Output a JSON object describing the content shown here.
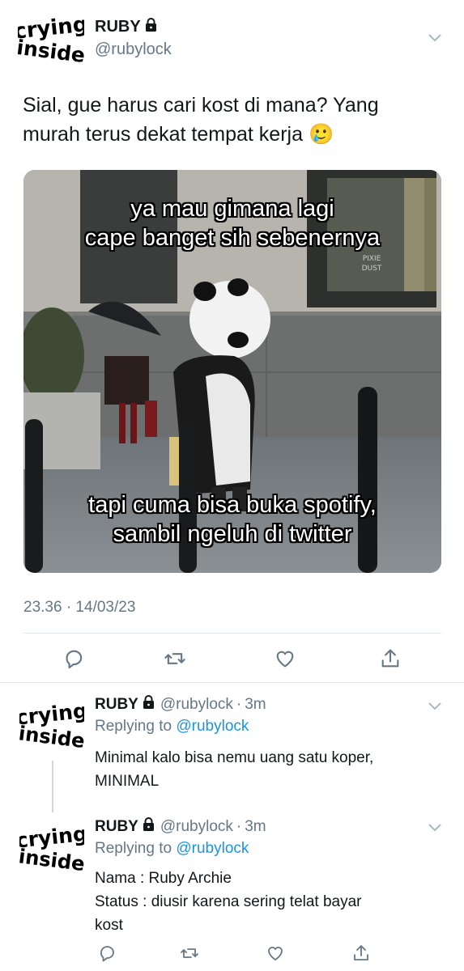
{
  "main_tweet": {
    "display_name": "RUBY",
    "handle": "@rubylock",
    "text_line1": "Sial, gue harus cari kost di mana? Yang",
    "text_line2": "murah terus dekat tempat kerja",
    "emoji": "🥲",
    "timestamp": "23.36 · 14/03/23"
  },
  "avatar": {
    "top_word": "crying",
    "bottom_word": "inside"
  },
  "meme": {
    "caption_top_line1": "ya mau gimana lagi",
    "caption_top_line2": "cape banget sih sebenernya",
    "caption_bottom_line1": "tapi cuma bisa buka spotify,",
    "caption_bottom_line2": "sambil ngeluh di twitter",
    "shop_sign_line1": "PIXIE",
    "shop_sign_line2": "DUST"
  },
  "replies": [
    {
      "display_name": "RUBY",
      "handle": "@rubylock",
      "dot": "·",
      "time": "3m",
      "replying_prefix": "Replying to",
      "replying_to": "@rubylock",
      "lines": [
        "Minimal kalo bisa nemu uang satu koper,",
        "MINIMAL"
      ]
    },
    {
      "display_name": "RUBY",
      "handle": "@rubylock",
      "dot": "·",
      "time": "3m",
      "replying_prefix": "Replying to",
      "replying_to": "@rubylock",
      "lines": [
        "Nama : Ruby Archie",
        "Status : diusir karena sering telat bayar",
        "kost"
      ]
    }
  ],
  "icons": {
    "reply": "reply-bubble-icon",
    "retweet": "retweet-icon",
    "like": "heart-icon",
    "share": "share-upload-icon",
    "lock": "lock-icon",
    "more": "chevron-down-icon"
  },
  "colors": {
    "text": "#14171a",
    "secondary": "#657786",
    "link": "#1b95e0",
    "divider": "#e1e8ed"
  }
}
